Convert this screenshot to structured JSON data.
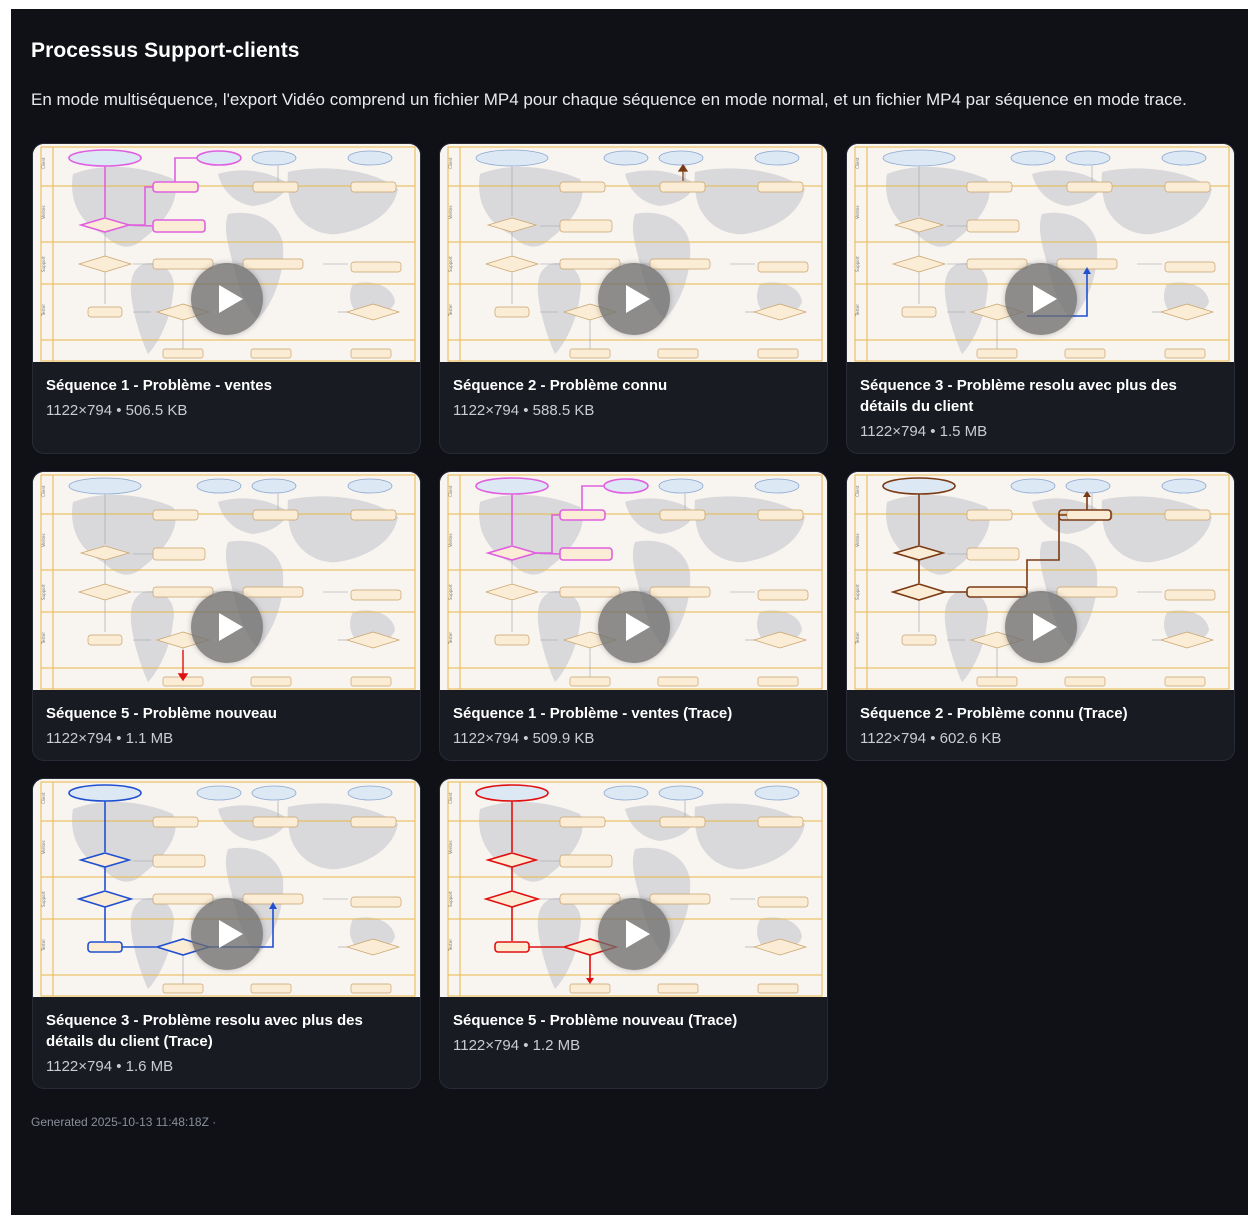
{
  "page": {
    "title": "Processus Support-clients",
    "description": "En mode multiséquence, l'export Vidéo comprend un fichier MP4 pour chaque séquence en mode normal, et un fichier MP4 par séquence en mode trace.",
    "footer": "Generated 2025-10-13 11:48:18Z ·"
  },
  "colors": {
    "background": "#0f1116",
    "card": "#181b22",
    "trace_magenta": "#e060e0",
    "trace_brown": "#7a3a14",
    "trace_blue": "#2050d0",
    "trace_red": "#e01010"
  },
  "play_icon": "play-icon",
  "videos": [
    {
      "title": "Séquence 1 - Problème - ventes",
      "info": "1122×794 • 506.5 KB"
    },
    {
      "title": "Séquence 2 - Problème connu",
      "info": "1122×794 • 588.5 KB"
    },
    {
      "title": "Séquence 3 - Problème resolu avec plus des détails du client",
      "info": "1122×794 • 1.5 MB"
    },
    {
      "title": "Séquence 5 - Problème nouveau",
      "info": "1122×794 • 1.1 MB"
    },
    {
      "title": "Séquence 1 - Problème - ventes (Trace)",
      "info": "1122×794 • 509.9 KB"
    },
    {
      "title": "Séquence 2 - Problème connu (Trace)",
      "info": "1122×794 • 602.6 KB"
    },
    {
      "title": "Séquence 3 - Problème resolu avec plus des détails du client (Trace)",
      "info": "1122×794 • 1.6 MB"
    },
    {
      "title": "Séquence 5 - Problème nouveau (Trace)",
      "info": "1122×794 • 1.2 MB"
    }
  ]
}
